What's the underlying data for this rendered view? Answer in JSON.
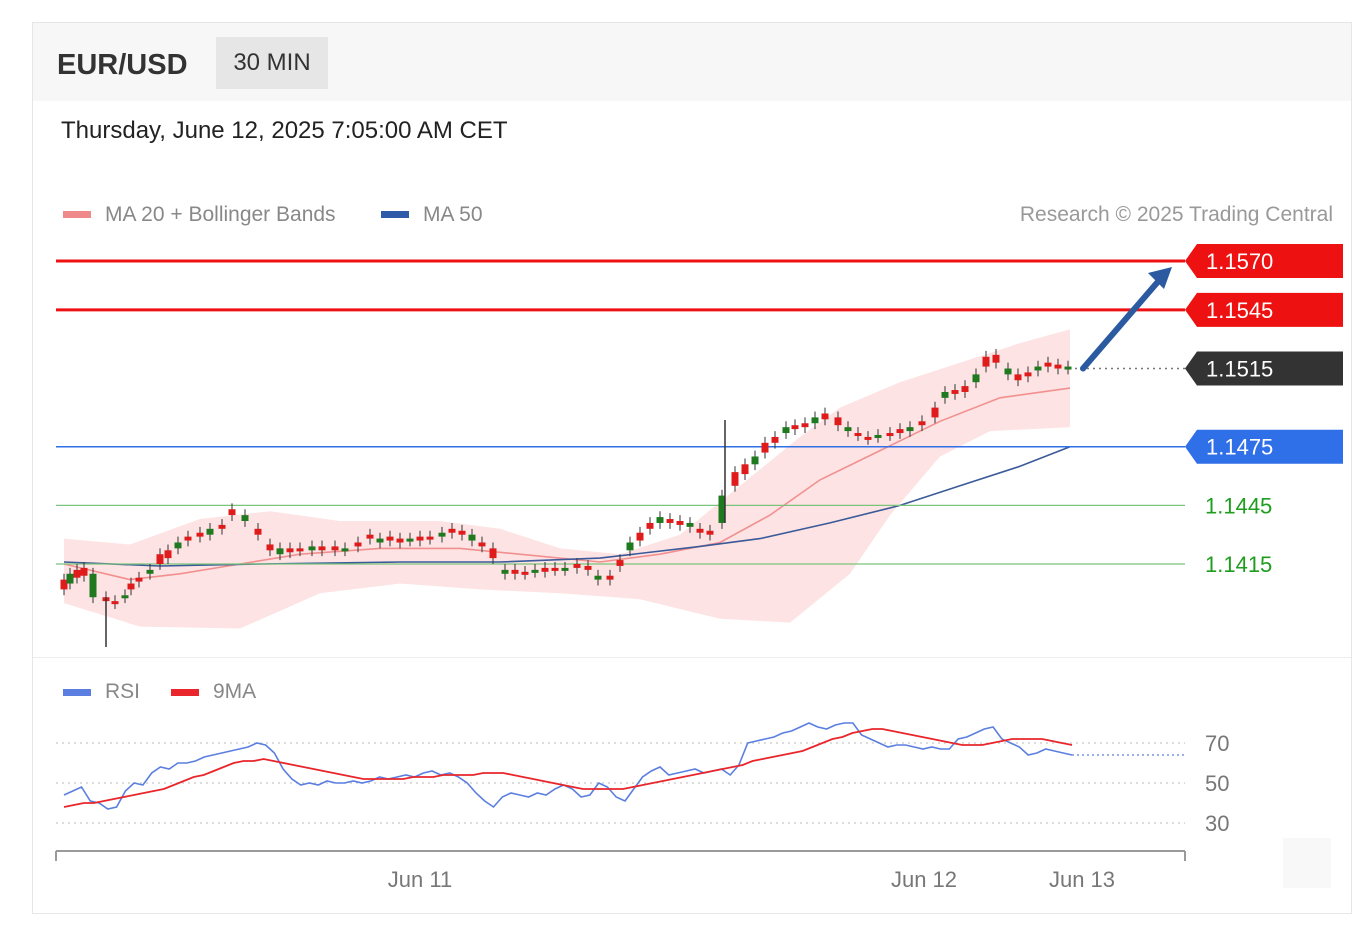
{
  "header": {
    "symbol": "EUR/USD",
    "timeframe": "30 MIN"
  },
  "date_label": "Thursday, June 12, 2025 7:05:00 AM CET",
  "legend": {
    "ma20_bb": {
      "label": "MA 20 + Bollinger Bands",
      "color": "#f08a8a"
    },
    "ma50": {
      "label": "MA 50",
      "color": "#2f5aa8"
    },
    "rsi": {
      "label": "RSI",
      "color": "#5b7fe0"
    },
    "rsi_ma": {
      "label": "9MA",
      "color": "#e8262c"
    }
  },
  "credit": "Research © 2025 Trading Central",
  "chart_data": {
    "type": "candlestick",
    "instrument": "EUR/USD",
    "interval": "30 MIN",
    "price_levels": [
      {
        "value": 1.157,
        "label": "1.1570",
        "kind": "resistance",
        "color": "#ee1111"
      },
      {
        "value": 1.1545,
        "label": "1.1545",
        "kind": "resistance",
        "color": "#ee1111"
      },
      {
        "value": 1.1515,
        "label": "1.1515",
        "kind": "last",
        "color": "#333333"
      },
      {
        "value": 1.1475,
        "label": "1.1475",
        "kind": "pivot",
        "color": "#2f6fe8"
      },
      {
        "value": 1.1445,
        "label": "1.1445",
        "kind": "support",
        "color": "#1f9d1f"
      },
      {
        "value": 1.1415,
        "label": "1.1415",
        "kind": "support",
        "color": "#1f9d1f"
      }
    ],
    "x_ticks": [
      "Jun 11",
      "Jun 12",
      "Jun 13"
    ],
    "projection": {
      "direction": "up",
      "from": 1.1515,
      "to": 1.157
    },
    "rsi": {
      "ticks": [
        70,
        50,
        30
      ],
      "values": [
        44,
        46,
        48,
        41,
        40,
        37,
        38,
        46,
        50,
        49,
        55,
        58,
        57,
        60,
        60,
        61,
        63,
        64,
        65,
        66,
        67,
        68,
        70,
        69,
        65,
        57,
        52,
        49,
        50,
        49,
        51,
        50,
        50,
        51,
        50,
        51,
        53,
        52,
        53,
        54,
        53,
        55,
        56,
        54,
        55,
        53,
        50,
        45,
        41,
        38,
        43,
        45,
        44,
        43,
        45,
        44,
        47,
        49,
        47,
        43,
        44,
        50,
        48,
        43,
        41,
        47,
        53,
        56,
        58,
        54,
        55,
        56,
        57,
        55,
        56,
        57,
        54,
        59,
        70,
        71,
        72,
        73,
        75,
        76,
        78,
        80,
        78,
        77,
        79,
        80,
        80,
        74,
        72,
        70,
        68,
        69,
        69,
        68,
        67,
        68,
        67,
        67,
        72,
        73,
        75,
        77,
        78,
        72,
        70,
        68,
        64,
        65,
        67,
        66,
        65,
        64
      ],
      "ma9": [
        38,
        39,
        40,
        40,
        41,
        42,
        43,
        44,
        45,
        46,
        47,
        49,
        51,
        53,
        54,
        56,
        58,
        60,
        61,
        61,
        62,
        61,
        60,
        59,
        58,
        57,
        56,
        55,
        54,
        53,
        52,
        52,
        52,
        52,
        52,
        53,
        53,
        53,
        54,
        54,
        54,
        54,
        55,
        55,
        55,
        54,
        53,
        52,
        51,
        50,
        49,
        48,
        47,
        47,
        47,
        47,
        47,
        48,
        49,
        50,
        51,
        52,
        53,
        54,
        55,
        56,
        57,
        58,
        59,
        61,
        62,
        63,
        64,
        65,
        66,
        68,
        70,
        72,
        73,
        75,
        76,
        77,
        77,
        76,
        75,
        74,
        73,
        72,
        71,
        70,
        69,
        69,
        69,
        70,
        71,
        72,
        72,
        72,
        72,
        71,
        70,
        69
      ]
    }
  }
}
